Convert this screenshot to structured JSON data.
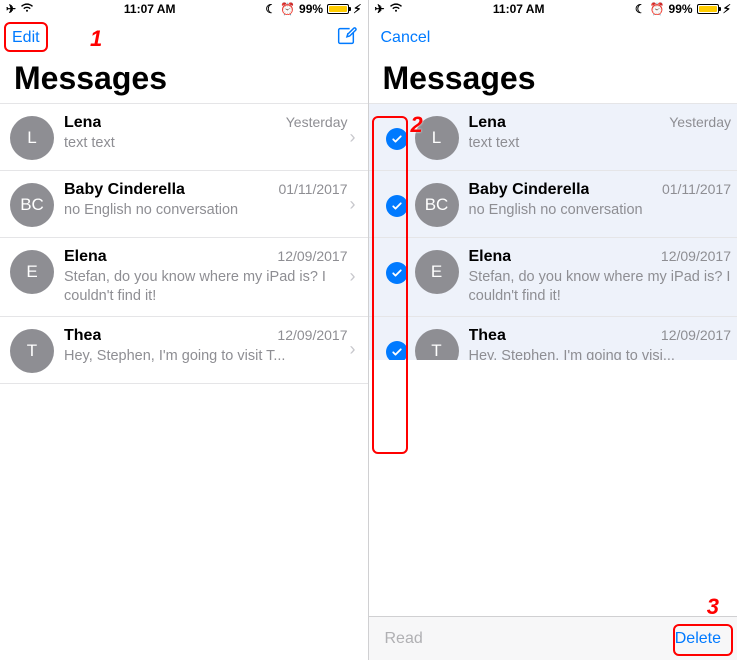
{
  "status": {
    "time": "11:07 AM",
    "battery_pct": "99%"
  },
  "left": {
    "edit": "Edit",
    "title": "Messages"
  },
  "right": {
    "cancel": "Cancel",
    "title": "Messages",
    "read": "Read",
    "delete": "Delete"
  },
  "conversations": [
    {
      "initials": "L",
      "name": "Lena",
      "date": "Yesterday",
      "preview": "text text"
    },
    {
      "initials": "BC",
      "name": "Baby Cinderella",
      "date": "01/11/2017",
      "preview": "no English no conversation"
    },
    {
      "initials": "E",
      "name": "Elena",
      "date": "12/09/2017",
      "preview": "Stefan, do you know where my iPad is? I couldn't find it!"
    },
    {
      "initials": "T",
      "name": "Thea",
      "date": "12/09/2017",
      "preview": "Hey, Stephen, I'm going to visit T..."
    }
  ],
  "conversations_r": [
    {
      "initials": "L",
      "name": "Lena",
      "date": "Yesterday",
      "preview": "text text"
    },
    {
      "initials": "BC",
      "name": "Baby Cinderella",
      "date": "01/11/2017",
      "preview": "no English no conversation"
    },
    {
      "initials": "E",
      "name": "Elena",
      "date": "12/09/2017",
      "preview": "Stefan, do you know where my iPad is? I couldn't find it!"
    },
    {
      "initials": "T",
      "name": "Thea",
      "date": "12/09/2017",
      "preview": "Hey, Stephen, I'm going to visi..."
    }
  ],
  "annotations": {
    "one": "1",
    "two": "2",
    "three": "3"
  }
}
